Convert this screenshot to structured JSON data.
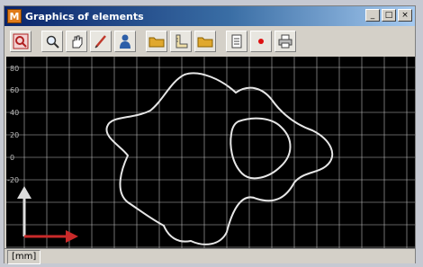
{
  "window": {
    "icon_letter": "M",
    "title": "Graphics of elements"
  },
  "toolbar": {
    "buttons": [
      {
        "name": "zoom-out-button",
        "icon": "magnifier-red-icon"
      },
      {
        "name": "zoom-in-button",
        "icon": "magnifier-icon"
      },
      {
        "name": "pan-button",
        "icon": "hand-icon"
      },
      {
        "name": "draw-button",
        "icon": "pencil-icon"
      },
      {
        "name": "user-button",
        "icon": "person-icon"
      },
      {
        "name": "open-button",
        "icon": "folder-icon"
      },
      {
        "name": "measure-button",
        "icon": "ruler-icon"
      },
      {
        "name": "folder-button",
        "icon": "folder-icon"
      },
      {
        "name": "export-button",
        "icon": "document-icon"
      },
      {
        "name": "point-button",
        "icon": "red-dot-icon"
      },
      {
        "name": "print-button",
        "icon": "printer-icon"
      }
    ]
  },
  "plot": {
    "y_ticks": [
      "80",
      "60",
      "40",
      "20",
      "0",
      "-20"
    ],
    "background": "#000000",
    "grid_color": "#bdbdbd",
    "contour_color": "#e6e6e6",
    "axis_indicator_color": "#c92a2a"
  },
  "status": {
    "units": "[mm]"
  }
}
